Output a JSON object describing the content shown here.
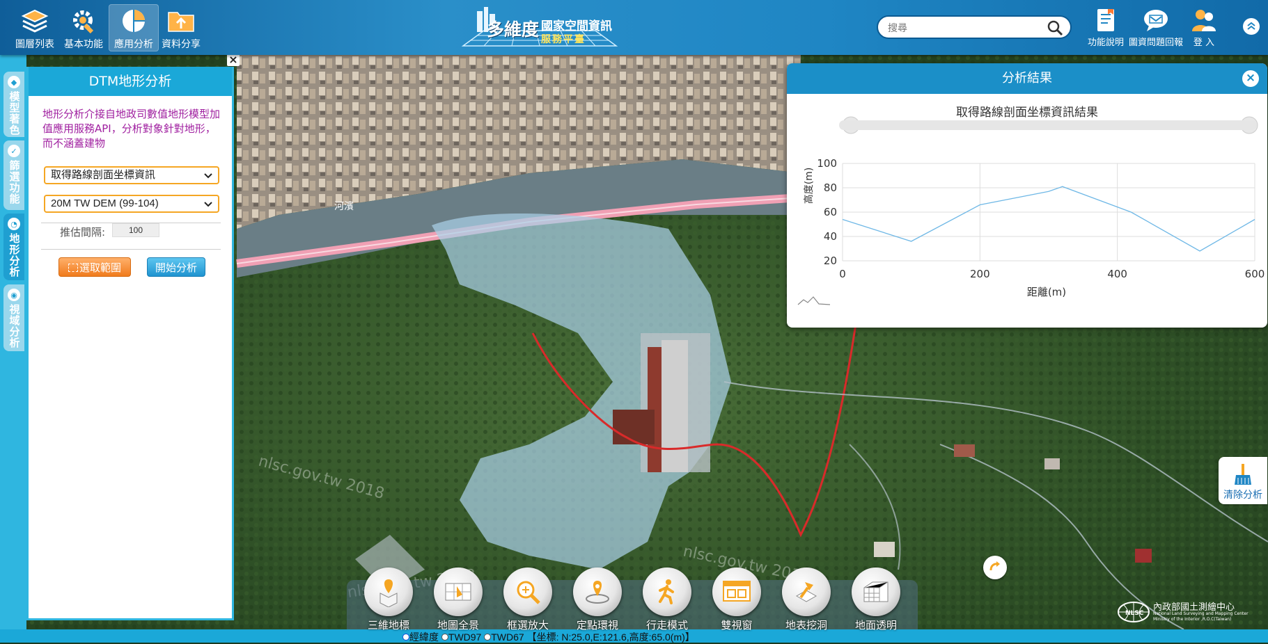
{
  "header": {
    "nav": [
      {
        "label": "圖層列表",
        "icon": "layers-icon"
      },
      {
        "label": "基本功能",
        "icon": "gear-tools-icon"
      },
      {
        "label": "應用分析",
        "icon": "pie-chart-icon",
        "active": true
      },
      {
        "label": "資料分享",
        "icon": "share-folder-icon"
      }
    ],
    "logo": {
      "big": "多維度",
      "line1": "國家空間資訊",
      "line2": "服務平臺"
    },
    "search_placeholder": "搜尋",
    "right_nav": [
      {
        "label": "功能說明",
        "icon": "document-icon"
      },
      {
        "label": "圖資問題回報",
        "icon": "chat-bubble-icon"
      },
      {
        "label": "登 入",
        "icon": "users-icon"
      }
    ]
  },
  "side_tabs": [
    {
      "label": "模型著色",
      "icon": "cube-icon"
    },
    {
      "label": "篩選功能",
      "icon": "check-circle-icon"
    },
    {
      "label": "地形分析",
      "icon": "pie-icon",
      "active": true
    },
    {
      "label": "視域分析",
      "icon": "eye-icon"
    }
  ],
  "panel": {
    "title": "DTM地形分析",
    "description": "地形分析介接自地政司數值地形模型加值應用服務API，分析對象針對地形，而不涵蓋建物",
    "analysis_type": "取得路線剖面坐標資訊",
    "dem_source": "20M TW DEM (99-104)",
    "interval_label": "推估間隔:",
    "interval_value": "100",
    "select_range_label": "選取範圍",
    "start_label": "開始分析"
  },
  "result": {
    "header": "分析結果",
    "close_symbol": "×"
  },
  "chart_data": {
    "type": "line",
    "title": "取得路線剖面坐標資訊結果",
    "xlabel": "距離(m)",
    "ylabel": "高度(m)",
    "xlim": [
      0,
      600
    ],
    "ylim": [
      20,
      100
    ],
    "xticks": [
      0,
      200,
      400,
      600
    ],
    "yticks": [
      20,
      40,
      60,
      80,
      100
    ],
    "grid": true,
    "line_color": "#6fb8e6",
    "x": [
      0,
      100,
      200,
      300,
      320,
      420,
      520,
      600
    ],
    "y": [
      54,
      36,
      66,
      77,
      81,
      60,
      28,
      54
    ]
  },
  "map": {
    "river_label": "河濱",
    "watermark": "nlsc.gov.tw 2018",
    "route_color": "#d92a2a",
    "highlight_color": "#a9cfe6"
  },
  "clear_button": {
    "label": "清除分析",
    "icon": "broom-icon"
  },
  "toolbar": [
    {
      "label": "三維地標",
      "icon": "3d-landmark-icon"
    },
    {
      "label": "地圖全景",
      "icon": "panorama-icon"
    },
    {
      "label": "框選放大",
      "icon": "zoom-box-icon"
    },
    {
      "label": "定點環視",
      "icon": "location-orbit-icon"
    },
    {
      "label": "行走模式",
      "icon": "walking-icon"
    },
    {
      "label": "雙視窗",
      "icon": "dual-window-icon"
    },
    {
      "label": "地表挖洞",
      "icon": "dig-icon"
    },
    {
      "label": "地面透明",
      "icon": "transparent-ground-icon"
    }
  ],
  "status": {
    "option1": "經緯度",
    "option2": "TWD97",
    "option3": "TWD67",
    "coords": "【坐標: N:25.0,E:121.6,高度:65.0(m)】"
  },
  "footer_logo": {
    "cn": "內政部國土測繪中心",
    "en1": "National Land Surveying and Mapping Center",
    "en2": "Ministry of the Interior ,R.O.C(Taiwan)",
    "abbr": "NLSC"
  }
}
